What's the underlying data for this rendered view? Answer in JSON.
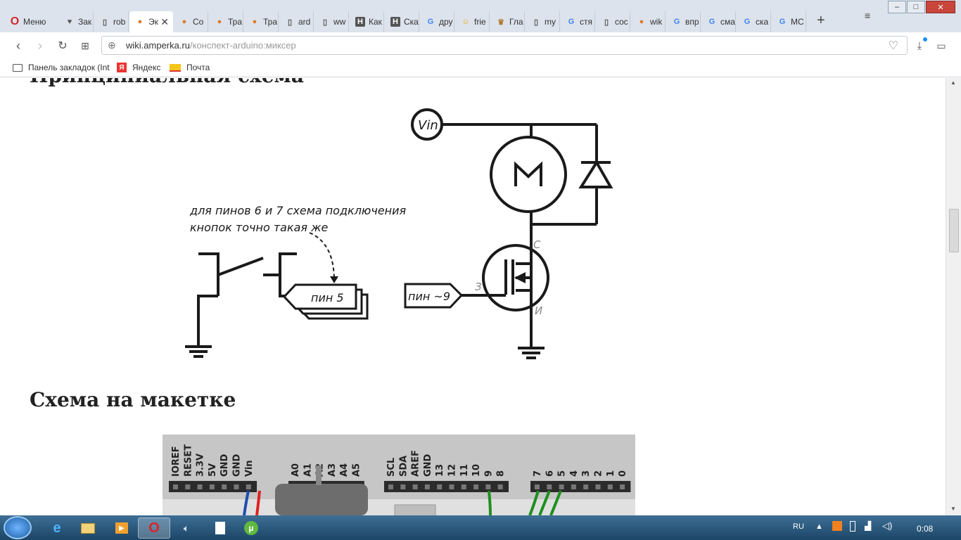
{
  "browser": {
    "menu_label": "Меню",
    "tabs": [
      {
        "label": "Зак",
        "icon": "heart-icon"
      },
      {
        "label": "rob",
        "icon": "page-icon"
      },
      {
        "label": "Эк",
        "icon": "amperka-icon",
        "active": true
      },
      {
        "label": "Со",
        "icon": "amperka-icon"
      },
      {
        "label": "Тра",
        "icon": "amperka-icon"
      },
      {
        "label": "Тра",
        "icon": "amperka-icon"
      },
      {
        "label": "ard",
        "icon": "page-icon"
      },
      {
        "label": "ww",
        "icon": "page-icon"
      },
      {
        "label": "Как",
        "icon": "habr-icon"
      },
      {
        "label": "Ска",
        "icon": "habr-icon"
      },
      {
        "label": "дру",
        "icon": "google-icon"
      },
      {
        "label": "frie",
        "icon": "emoji-icon"
      },
      {
        "label": "Гла",
        "icon": "crown-icon"
      },
      {
        "label": "my",
        "icon": "page-icon"
      },
      {
        "label": "стя",
        "icon": "google-icon"
      },
      {
        "label": "coc",
        "icon": "page-icon"
      },
      {
        "label": "wik",
        "icon": "amperka-icon"
      },
      {
        "label": "впр",
        "icon": "google-icon"
      },
      {
        "label": "сма",
        "icon": "google-icon"
      },
      {
        "label": "ска",
        "icon": "google-icon"
      },
      {
        "label": "МС",
        "icon": "google-icon"
      }
    ],
    "url_domain": "wiki.amperka.ru",
    "url_path": "/конспект-arduino:миксер",
    "bookmarks": [
      {
        "label": "Панель закладок (Int",
        "icon": "folder-icon"
      },
      {
        "label": "Яндекс",
        "icon": "yandex-icon"
      },
      {
        "label": "Почта",
        "icon": "mail-icon"
      }
    ]
  },
  "page": {
    "heading_schematic": "Принципиальная схема",
    "heading_breadboard": "Схема на макетке",
    "schematic": {
      "vin_label": "Vin",
      "note_line1": "для пинов 6 и 7 схема подключения",
      "note_line2": "кнопок точно такая же",
      "pin5_label": "пин 5",
      "pin9_label": "пин ~9",
      "gate_label": "З",
      "drain_label": "С",
      "source_label": "И"
    },
    "breadboard": {
      "power_pins": [
        "IOREF",
        "RESET",
        "3.3V",
        "5V",
        "GND",
        "GND",
        "Vin"
      ],
      "analog_pins": [
        "A0",
        "A1",
        "A2",
        "A3",
        "A4",
        "A5"
      ],
      "digital_pins_left": [
        "SCL",
        "SDA",
        "AREF",
        "GND",
        "13",
        "12",
        "11",
        "10",
        "9",
        "8"
      ],
      "digital_pins_right": [
        "7",
        "6",
        "5",
        "4",
        "3",
        "2",
        "1",
        "0"
      ]
    }
  },
  "taskbar": {
    "lang": "RU",
    "time": "0:08"
  },
  "colors": {
    "tabbar_bg": "#dce3ec",
    "opera_red": "#d6262d",
    "taskbar_blue": "#2a5a80"
  }
}
